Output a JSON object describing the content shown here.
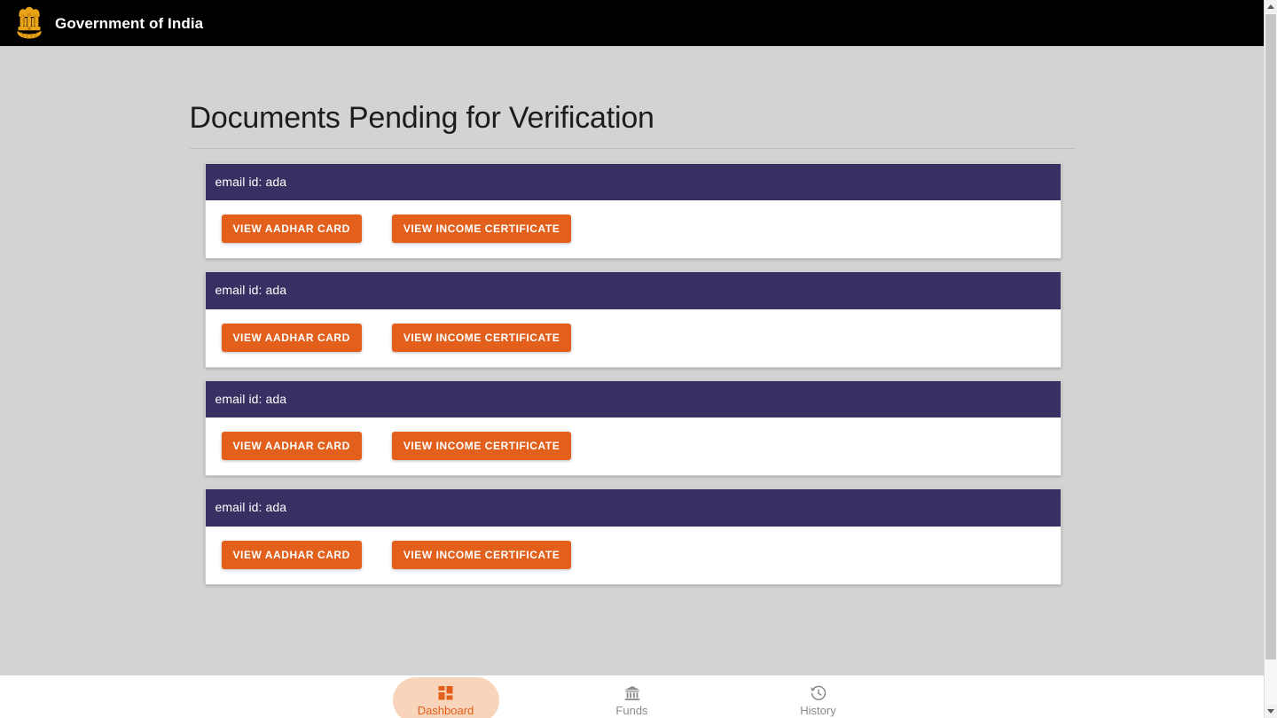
{
  "header": {
    "title": "Government of India",
    "emblem_icon": "india-national-emblem-icon",
    "background": "#000000"
  },
  "main": {
    "page_title": "Documents Pending for Verification",
    "cards": [
      {
        "email_label": "email id: ada",
        "buttons": [
          {
            "label": "VIEW AADHAR CARD",
            "name": "view-aadhar-card-button"
          },
          {
            "label": "VIEW INCOME CERTIFICATE",
            "name": "view-income-certificate-button"
          }
        ]
      },
      {
        "email_label": "email id: ada",
        "buttons": [
          {
            "label": "VIEW AADHAR CARD",
            "name": "view-aadhar-card-button"
          },
          {
            "label": "VIEW INCOME CERTIFICATE",
            "name": "view-income-certificate-button"
          }
        ]
      },
      {
        "email_label": "email id: ada",
        "buttons": [
          {
            "label": "VIEW AADHAR CARD",
            "name": "view-aadhar-card-button"
          },
          {
            "label": "VIEW INCOME CERTIFICATE",
            "name": "view-income-certificate-button"
          }
        ]
      },
      {
        "email_label": "email id: ada",
        "buttons": [
          {
            "label": "VIEW AADHAR CARD",
            "name": "view-aadhar-card-button"
          },
          {
            "label": "VIEW INCOME CERTIFICATE",
            "name": "view-income-certificate-button"
          }
        ]
      }
    ]
  },
  "bottom_nav": {
    "items": [
      {
        "label": "Dashboard",
        "icon": "dashboard-grid-icon",
        "active": true
      },
      {
        "label": "Funds",
        "icon": "bank-building-icon",
        "active": false
      },
      {
        "label": "History",
        "icon": "clock-rotate-left-icon",
        "active": false
      }
    ]
  },
  "colors": {
    "accent_orange": "#e2601c",
    "card_header_purple": "#392f63",
    "active_pill": "#f8d4bb",
    "page_background": "#d3d3d3",
    "header_black": "#000000",
    "muted_text": "#8a8a8a"
  },
  "scrollbar": {
    "up_arrow": "scroll-up-arrow-icon",
    "down_arrow": "scroll-down-arrow-icon"
  }
}
